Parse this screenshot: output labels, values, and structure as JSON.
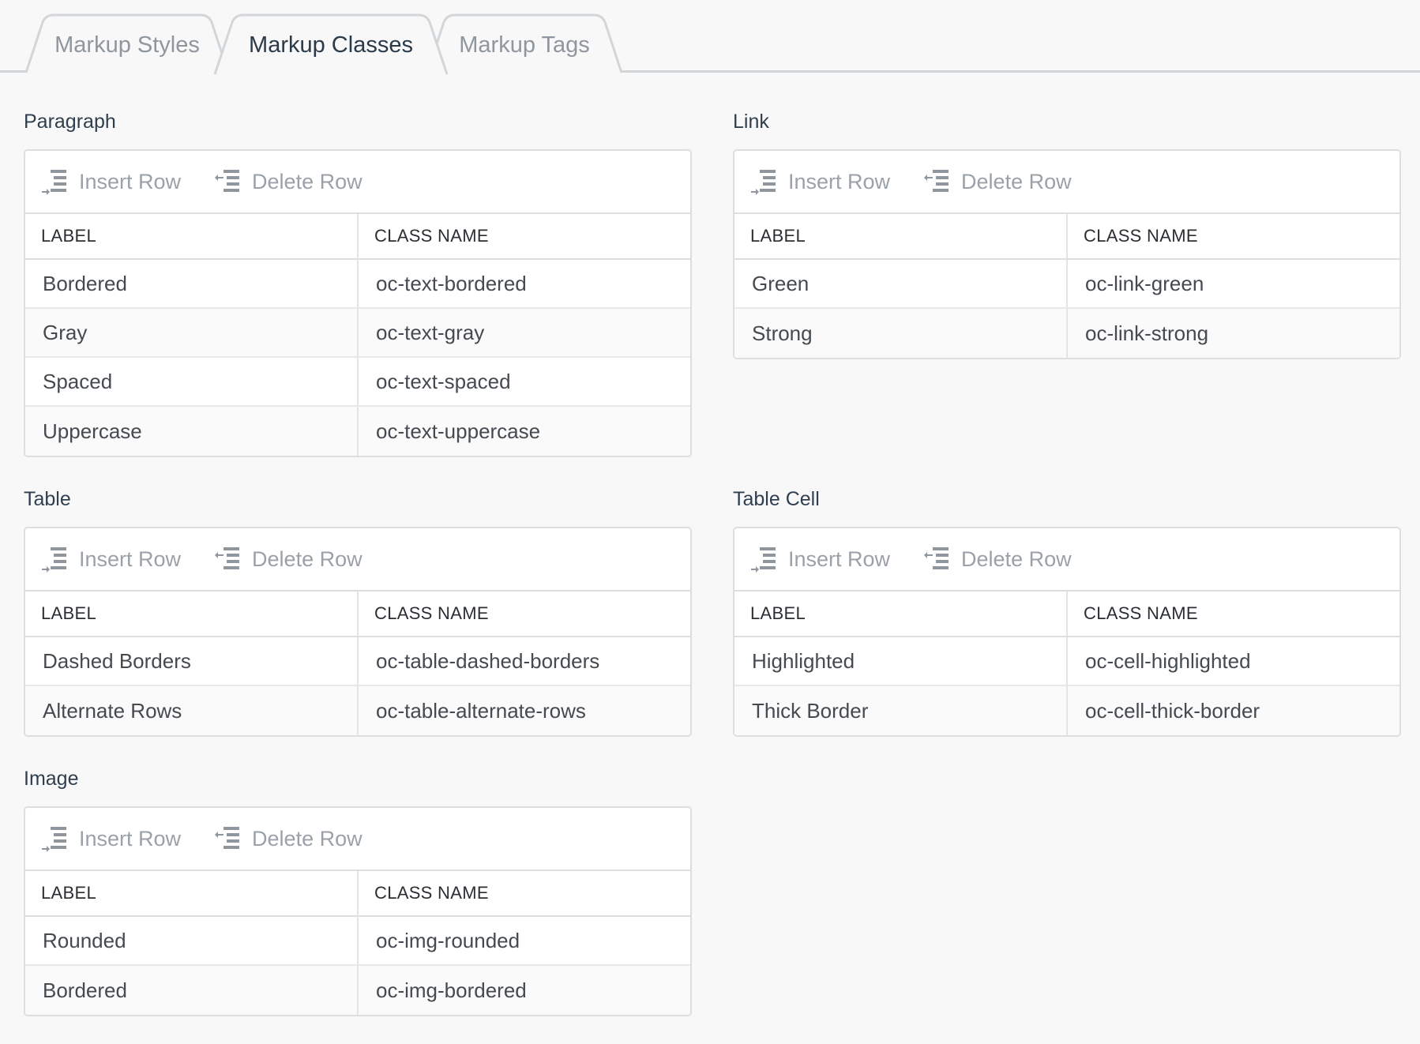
{
  "tabs": [
    {
      "label": "Markup Styles",
      "active": false
    },
    {
      "label": "Markup Classes",
      "active": true
    },
    {
      "label": "Markup Tags",
      "active": false
    }
  ],
  "toolbar": {
    "insert_label": "Insert Row",
    "delete_label": "Delete Row"
  },
  "columns": {
    "label": "LABEL",
    "class_name": "CLASS NAME"
  },
  "sections": {
    "paragraph": {
      "title": "Paragraph",
      "rows": [
        {
          "label": "Bordered",
          "class_name": "oc-text-bordered"
        },
        {
          "label": "Gray",
          "class_name": "oc-text-gray"
        },
        {
          "label": "Spaced",
          "class_name": "oc-text-spaced"
        },
        {
          "label": "Uppercase",
          "class_name": "oc-text-uppercase"
        }
      ]
    },
    "link": {
      "title": "Link",
      "rows": [
        {
          "label": "Green",
          "class_name": "oc-link-green"
        },
        {
          "label": "Strong",
          "class_name": "oc-link-strong"
        }
      ]
    },
    "table": {
      "title": "Table",
      "rows": [
        {
          "label": "Dashed Borders",
          "class_name": "oc-table-dashed-borders"
        },
        {
          "label": "Alternate Rows",
          "class_name": "oc-table-alternate-rows"
        }
      ]
    },
    "table_cell": {
      "title": "Table Cell",
      "rows": [
        {
          "label": "Highlighted",
          "class_name": "oc-cell-highlighted"
        },
        {
          "label": "Thick Border",
          "class_name": "oc-cell-thick-border"
        }
      ]
    },
    "image": {
      "title": "Image",
      "rows": [
        {
          "label": "Rounded",
          "class_name": "oc-img-rounded"
        },
        {
          "label": "Bordered",
          "class_name": "oc-img-bordered"
        }
      ]
    }
  },
  "colors": {
    "background": "#f8f8f8",
    "panel": "#ffffff",
    "border": "#dcdfe2",
    "muted_text": "#9aa1a8",
    "title_text": "#2f3f4f"
  }
}
